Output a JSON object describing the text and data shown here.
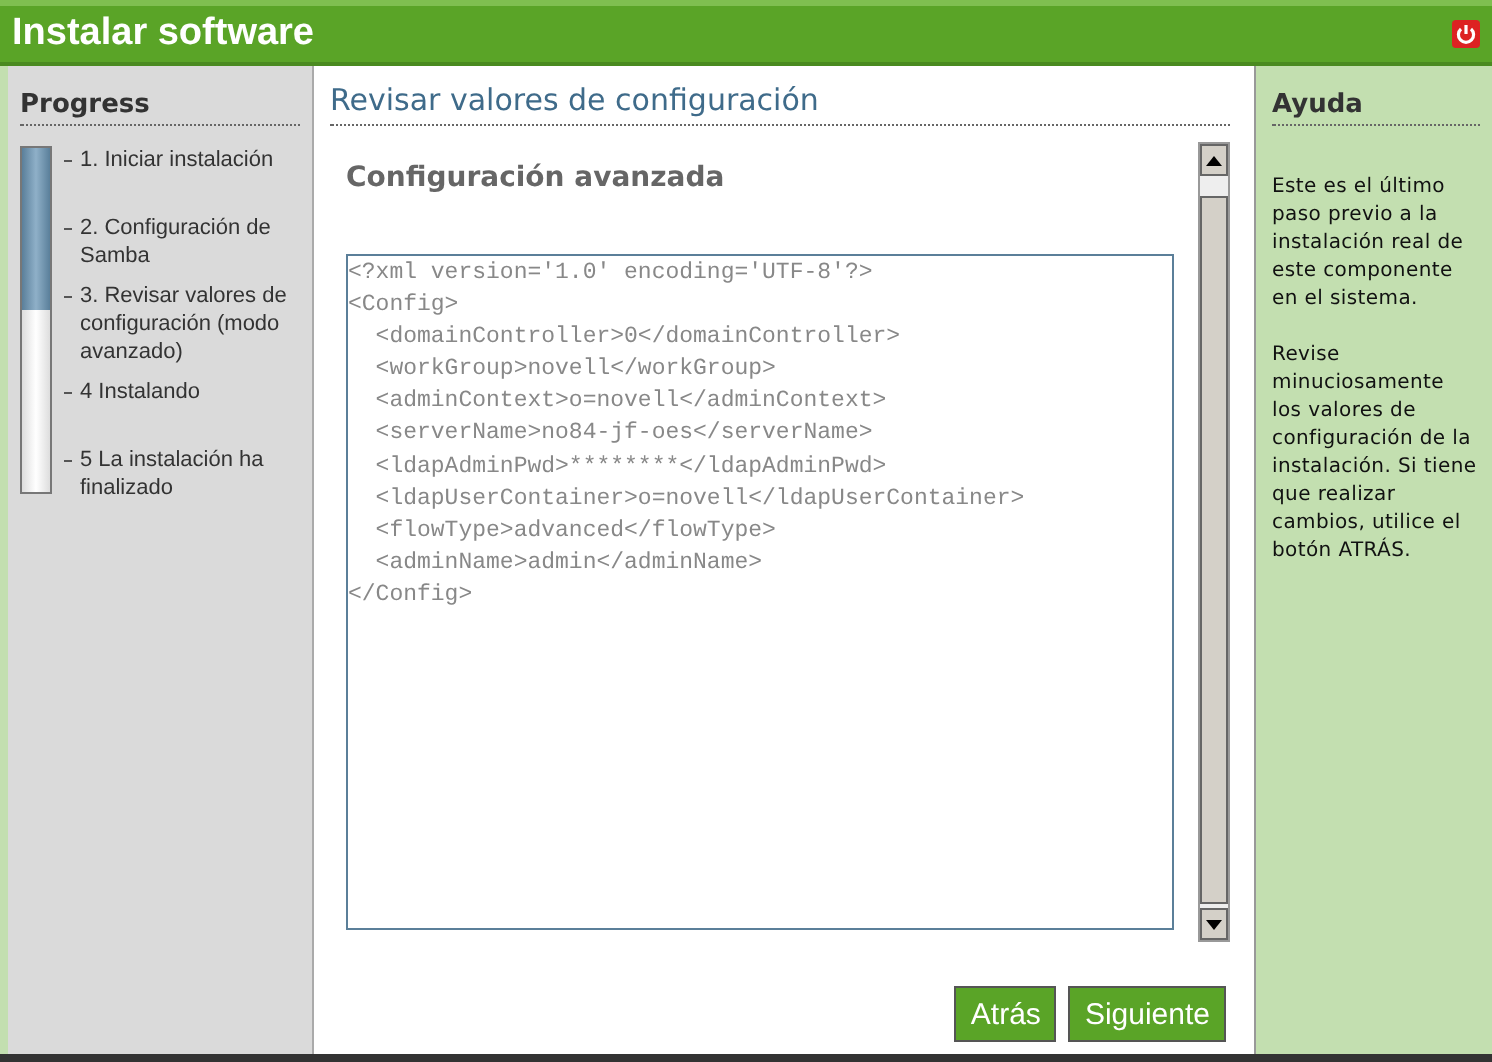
{
  "window": {
    "title": "Instalar software"
  },
  "progress": {
    "title": "Progress",
    "level": 0.47,
    "steps": [
      {
        "label": "1. Iniciar instalación"
      },
      {
        "label": "2. Configuración de Samba"
      },
      {
        "label": "3. Revisar valores de configuración (modo avanzado)"
      },
      {
        "label": "4 Instalando"
      },
      {
        "label": "5 La instalación ha finalizado"
      }
    ]
  },
  "main": {
    "title": "Revisar valores de configuración",
    "section": "Configuración avanzada",
    "config_lines": [
      "<?xml version='1.0' encoding='UTF-8'?>",
      "<Config>",
      "  <domainController>0</domainController>",
      "  <workGroup>novell</workGroup>",
      "  <adminContext>o=novell</adminContext>",
      "  <serverName>no84-jf-oes</serverName>",
      "  <ldapAdminPwd>********</ldapAdminPwd>",
      "  <ldapUserContainer>o=novell</ldapUserContainer>",
      "  <flowType>advanced</flowType>",
      "  <adminName>admin</adminName>",
      "</Config>"
    ]
  },
  "buttons": [
    "Atrás",
    "Siguiente"
  ],
  "help": {
    "title": "Ayuda",
    "paragraphs": [
      "Este es el último paso previo a la instalación real de este componente en el sistema.",
      "Revise minuciosamente los valores de configuración de la instalación. Si tiene que realizar cambios, utilice el botón ATRÁS."
    ]
  }
}
